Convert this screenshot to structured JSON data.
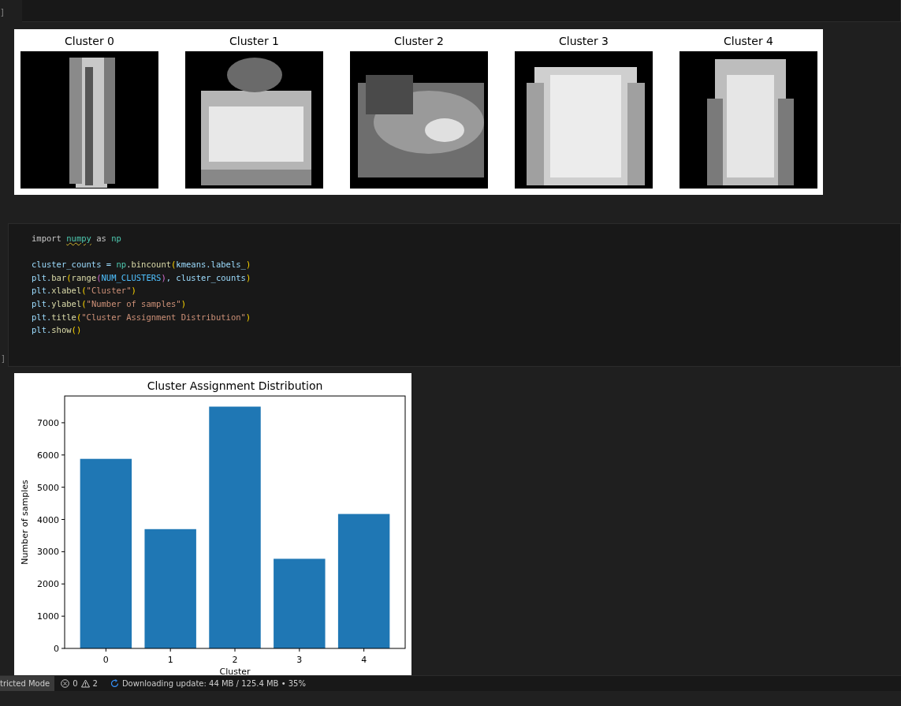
{
  "top_cell": {
    "execution_count": "]"
  },
  "cluster_output": {
    "panels": [
      {
        "title": "Cluster 0",
        "kind": "picture"
      },
      {
        "title": "Cluster 1",
        "kind": "picture"
      },
      {
        "title": "Cluster 2",
        "kind": "picture"
      },
      {
        "title": "Cluster 3",
        "kind": "picture"
      },
      {
        "title": "Cluster 4",
        "kind": "picture"
      }
    ]
  },
  "code_cell": {
    "execution_count": "]",
    "lines": [
      {
        "blank_before": false,
        "tokens": [
          {
            "text": "import ",
            "kind": "keyword"
          },
          {
            "text": "numpy",
            "kind": "unresolved"
          },
          {
            "text": " as ",
            "kind": "keyword"
          },
          {
            "text": "np",
            "kind": "module"
          }
        ]
      },
      {
        "blank_before": true,
        "tokens": [
          {
            "text": "cluster_counts = ",
            "kind": "var"
          },
          {
            "text": "np",
            "kind": "module"
          },
          {
            "text": ".",
            "kind": "plain"
          },
          {
            "text": "bincount",
            "kind": "func"
          },
          {
            "text": "(",
            "kind": "paren"
          },
          {
            "text": "kmeans.labels_",
            "kind": "var"
          },
          {
            "text": ")",
            "kind": "paren"
          }
        ]
      },
      {
        "blank_before": false,
        "tokens": [
          {
            "text": "plt.",
            "kind": "var"
          },
          {
            "text": "bar",
            "kind": "func"
          },
          {
            "text": "(",
            "kind": "paren"
          },
          {
            "text": "range",
            "kind": "func"
          },
          {
            "text": "(",
            "kind": "paren2"
          },
          {
            "text": "NUM_CLUSTERS",
            "kind": "const"
          },
          {
            "text": ")",
            "kind": "paren2"
          },
          {
            "text": ", cluster_counts",
            "kind": "var"
          },
          {
            "text": ")",
            "kind": "paren"
          }
        ]
      },
      {
        "blank_before": false,
        "tokens": [
          {
            "text": "plt.",
            "kind": "var"
          },
          {
            "text": "xlabel",
            "kind": "func"
          },
          {
            "text": "(",
            "kind": "paren"
          },
          {
            "text": "\"Cluster\"",
            "kind": "string"
          },
          {
            "text": ")",
            "kind": "paren"
          }
        ]
      },
      {
        "blank_before": false,
        "tokens": [
          {
            "text": "plt.",
            "kind": "var"
          },
          {
            "text": "ylabel",
            "kind": "func"
          },
          {
            "text": "(",
            "kind": "paren"
          },
          {
            "text": "\"Number of samples\"",
            "kind": "string"
          },
          {
            "text": ")",
            "kind": "paren"
          }
        ]
      },
      {
        "blank_before": false,
        "tokens": [
          {
            "text": "plt.",
            "kind": "var"
          },
          {
            "text": "title",
            "kind": "func"
          },
          {
            "text": "(",
            "kind": "paren"
          },
          {
            "text": "\"Cluster Assignment Distribution\"",
            "kind": "string"
          },
          {
            "text": ")",
            "kind": "paren"
          }
        ]
      },
      {
        "blank_before": false,
        "tokens": [
          {
            "text": "plt.",
            "kind": "var"
          },
          {
            "text": "show",
            "kind": "func"
          },
          {
            "text": "()",
            "kind": "paren"
          }
        ]
      }
    ]
  },
  "chart_output": {
    "chart_data": {
      "type": "bar",
      "title": "Cluster Assignment Distribution",
      "xlabel": "Cluster",
      "ylabel": "Number of samples",
      "categories": [
        "0",
        "1",
        "2",
        "3",
        "4"
      ],
      "series": [
        {
          "color": "#1f77b4",
          "values": [
            5880,
            3700,
            7500,
            2780,
            4170
          ]
        }
      ],
      "ylim": [
        0,
        7830
      ],
      "yticks": [
        0,
        1000,
        2000,
        3000,
        4000,
        5000,
        6000,
        7000
      ]
    }
  },
  "status_bar": {
    "mode": "tricted Mode",
    "errors": "0",
    "warnings": "2",
    "downloading": true,
    "progress": "Downloading update: 44 MB / 125.4 MB • 35%"
  }
}
